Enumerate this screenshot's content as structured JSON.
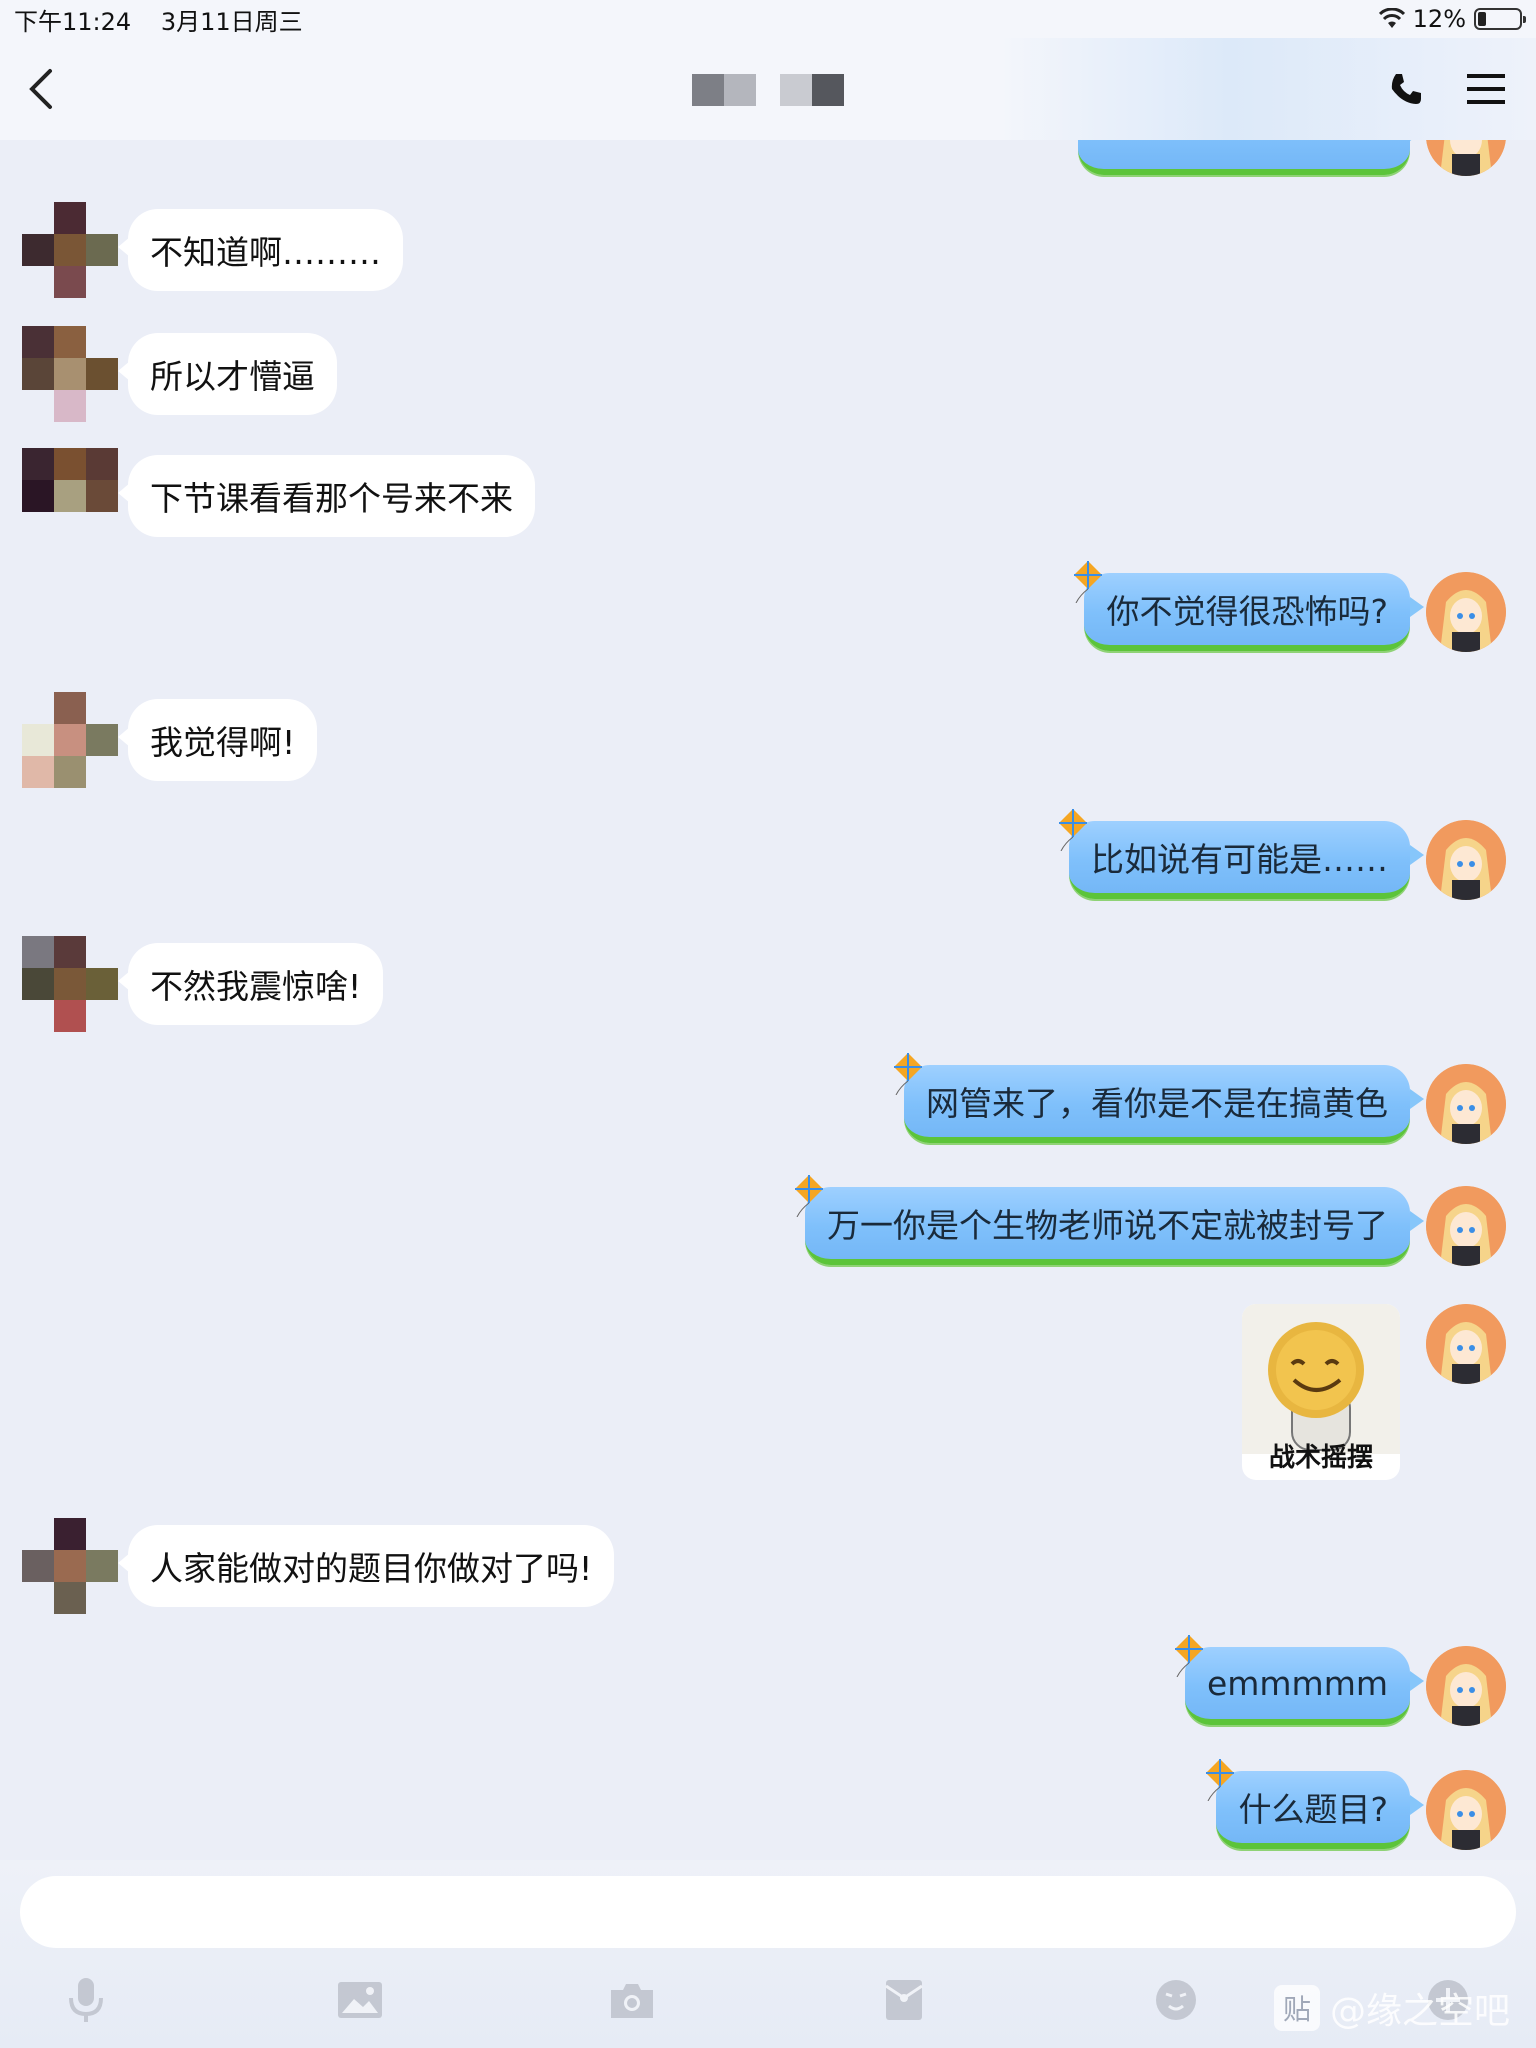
{
  "status_bar": {
    "time": "下午11:24",
    "date": "3月11日周三",
    "battery": "12%"
  },
  "header": {
    "title_blocks": [
      "#7d7f86",
      "#b4b6bd",
      "#c9cbd1",
      "#55575d"
    ]
  },
  "messages": [
    {
      "side": "right",
      "text": "…",
      "partial": true
    },
    {
      "side": "left",
      "text": "不知道啊………"
    },
    {
      "side": "left",
      "text": "所以才懵逼"
    },
    {
      "side": "left",
      "text": "下节课看看那个号来不来"
    },
    {
      "side": "right",
      "text": "你不觉得很恐怖吗?"
    },
    {
      "side": "left",
      "text": "我觉得啊!"
    },
    {
      "side": "right",
      "text": "比如说有可能是……"
    },
    {
      "side": "left",
      "text": "不然我震惊啥!"
    },
    {
      "side": "right",
      "text": "网管来了，看你是不是在搞黄色"
    },
    {
      "side": "right",
      "text": "万一你是个生物老师说不定就被封号了"
    },
    {
      "side": "right",
      "sticker_caption": "战术摇摆"
    },
    {
      "side": "left",
      "text": "人家能做对的题目你做对了吗!"
    },
    {
      "side": "right",
      "text": "emmmmm"
    },
    {
      "side": "right",
      "text": "什么题目?"
    }
  ],
  "input": {
    "placeholder": ""
  },
  "toolbar": {
    "icons": [
      "microphone-icon",
      "image-icon",
      "camera-icon",
      "red-packet-icon",
      "emoji-icon",
      "plus-icon"
    ]
  },
  "watermark": {
    "badge": "贴",
    "text": "@缘之空吧"
  },
  "colors": {
    "background": "#ebeef7",
    "self_bubble": "#86c6fa",
    "other_bubble": "#ffffff",
    "bubble_grass": "#5cc43a"
  }
}
